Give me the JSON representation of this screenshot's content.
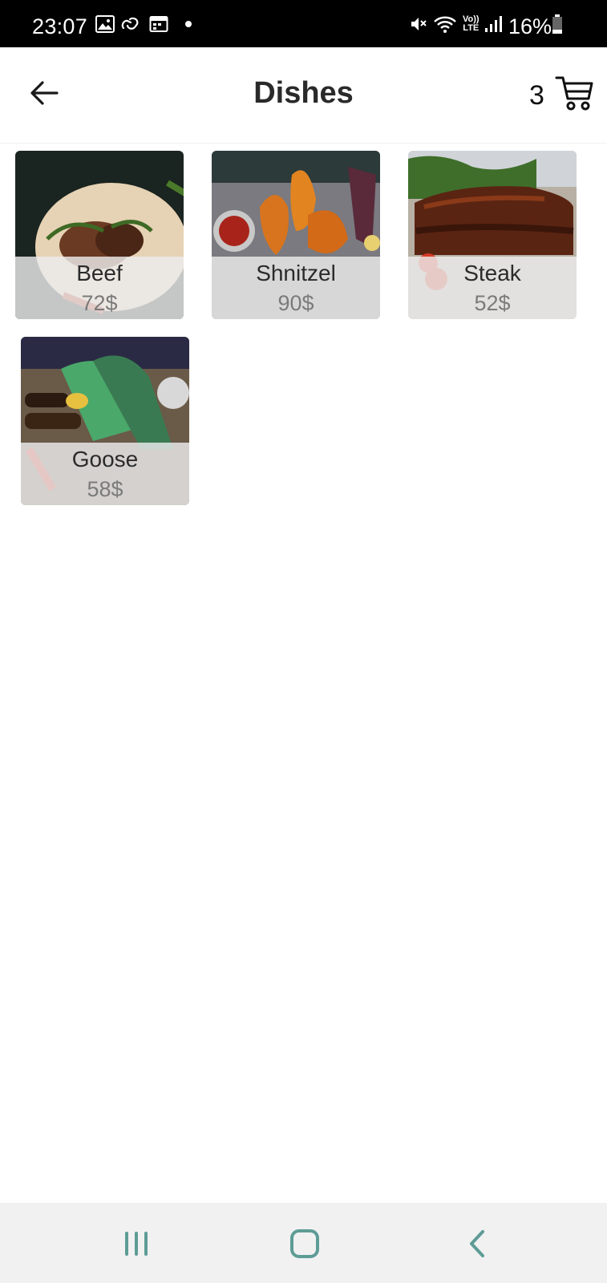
{
  "status_bar": {
    "time": "23:07",
    "battery": "16%",
    "icons": [
      "gallery-icon",
      "link-icon",
      "calendar-icon",
      "dot-icon",
      "mute-icon",
      "wifi-icon",
      "volte-icon",
      "signal-icon",
      "battery-icon"
    ],
    "volte_text_top": "Vo))",
    "volte_text_bottom": "LTE"
  },
  "header": {
    "title": "Dishes",
    "back_icon": "arrow-left-icon",
    "cart_count": "3",
    "cart_icon": "cart-icon"
  },
  "dishes": [
    {
      "name": "Beef",
      "price": "72$"
    },
    {
      "name": "Shnitzel",
      "price": "90$"
    },
    {
      "name": "Steak",
      "price": "52$"
    },
    {
      "name": "Goose",
      "price": "58$"
    }
  ],
  "nav_bar": {
    "icons": [
      "recent-apps-icon",
      "home-icon",
      "back-icon"
    ],
    "color": "#5e9c96"
  }
}
